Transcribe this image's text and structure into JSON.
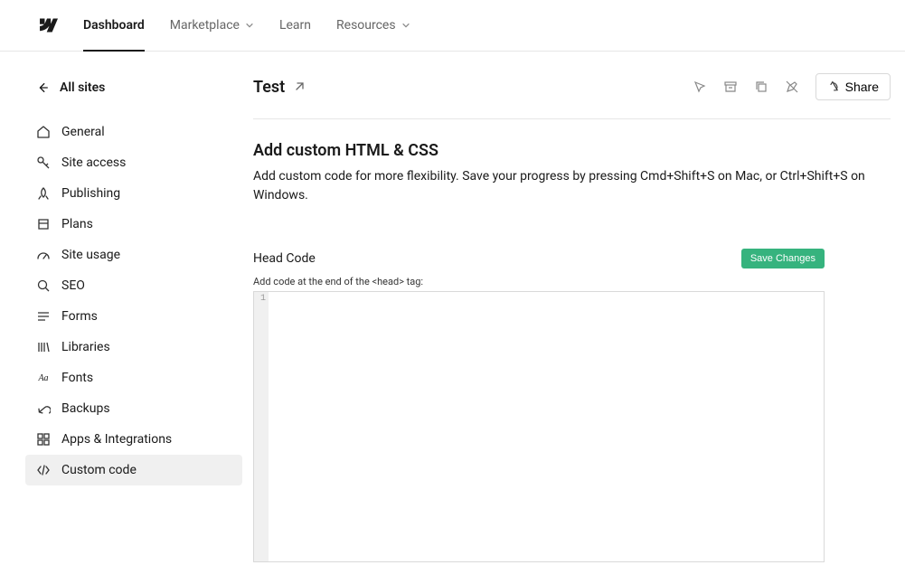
{
  "topnav": {
    "items": [
      {
        "label": "Dashboard",
        "active": true,
        "dropdown": false
      },
      {
        "label": "Marketplace",
        "active": false,
        "dropdown": true
      },
      {
        "label": "Learn",
        "active": false,
        "dropdown": false
      },
      {
        "label": "Resources",
        "active": false,
        "dropdown": true
      }
    ]
  },
  "sidebar": {
    "back_label": "All sites",
    "items": [
      {
        "label": "General",
        "icon": "home",
        "active": false
      },
      {
        "label": "Site access",
        "icon": "key",
        "active": false
      },
      {
        "label": "Publishing",
        "icon": "rocket",
        "active": false
      },
      {
        "label": "Plans",
        "icon": "plans",
        "active": false
      },
      {
        "label": "Site usage",
        "icon": "gauge",
        "active": false
      },
      {
        "label": "SEO",
        "icon": "search",
        "active": false
      },
      {
        "label": "Forms",
        "icon": "lines",
        "active": false
      },
      {
        "label": "Libraries",
        "icon": "bars",
        "active": false
      },
      {
        "label": "Fonts",
        "icon": "fonts",
        "active": false
      },
      {
        "label": "Backups",
        "icon": "undo",
        "active": false
      },
      {
        "label": "Apps & Integrations",
        "icon": "grid",
        "active": false
      },
      {
        "label": "Custom code",
        "icon": "code",
        "active": true
      }
    ]
  },
  "header": {
    "site_name": "Test",
    "share_label": "Share"
  },
  "content": {
    "title": "Add custom HTML & CSS",
    "description": "Add custom code for more flexibility. Save your progress by pressing Cmd+Shift+S on Mac, or Ctrl+Shift+S on Windows.",
    "head_code_title": "Head Code",
    "save_label": "Save Changes",
    "head_code_label": "Add code at the end of the <head> tag:",
    "gutter_line": "1",
    "editor_value": ""
  },
  "colors": {
    "save_button_bg": "#36b37e"
  }
}
